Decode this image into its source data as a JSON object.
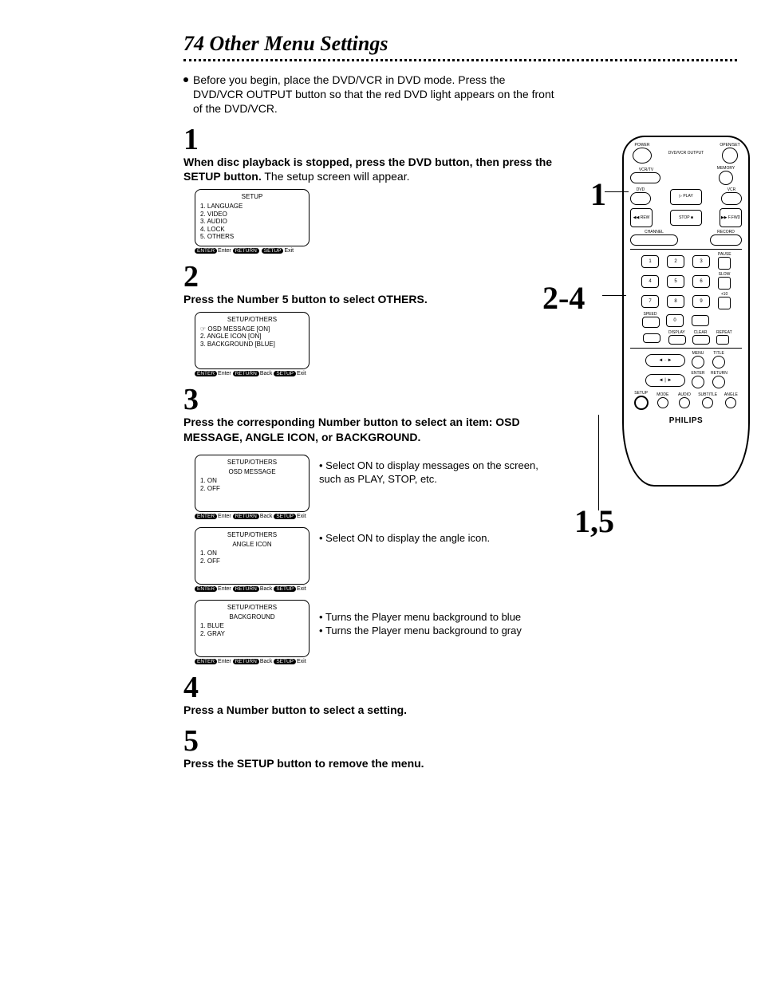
{
  "title": "74  Other Menu Settings",
  "intro": "Before you begin, place the DVD/VCR in DVD mode. Press the DVD/VCR OUTPUT button so that the red DVD light appears on the front of the DVD/VCR.",
  "steps": {
    "s1": {
      "num": "1",
      "text_bold": "When disc playback is stopped, press the DVD button, then press the SETUP button.",
      "text_rest": " The setup screen will appear."
    },
    "s2": {
      "num": "2",
      "text_bold": "Press the Number 5 button to select OTHERS."
    },
    "s3": {
      "num": "3",
      "text_bold": "Press the corresponding Number button to select an item: OSD MESSAGE, ANGLE ICON, or BACKGROUND."
    },
    "s4": {
      "num": "4",
      "text_bold": "Press a Number button to select a setting."
    },
    "s5": {
      "num": "5",
      "text_bold": "Press the SETUP button to remove the menu."
    }
  },
  "menu1": {
    "title": "SETUP",
    "items": [
      "1. LANGUAGE",
      "2. VIDEO",
      "3. AUDIO",
      "4. LOCK",
      "5. OTHERS"
    ]
  },
  "menu2": {
    "title": "SETUP/OTHERS",
    "items": [
      "☞ OSD MESSAGE  [ON]",
      "2. ANGLE ICON     [ON]",
      "3. BACKGROUND  [BLUE]"
    ]
  },
  "menu3a": {
    "title": "SETUP/OTHERS",
    "sub": "OSD MESSAGE",
    "items": [
      "1. ON",
      "2. OFF"
    ],
    "annot": "Select ON to display messages on the screen, such as PLAY, STOP, etc."
  },
  "menu3b": {
    "title": "SETUP/OTHERS",
    "sub": "ANGLE ICON",
    "items": [
      "1. ON",
      "2. OFF"
    ],
    "annot": "Select ON to display the angle icon."
  },
  "menu3c": {
    "title": "SETUP/OTHERS",
    "sub": "BACKGROUND",
    "items": [
      "1. BLUE",
      "2. GRAY"
    ],
    "annot1": "Turns the Player menu background to blue",
    "annot2": "Turns the Player menu background to gray"
  },
  "footer_labels": {
    "enter": "ENTER",
    "enter_t": "Enter",
    "return": "RETURN",
    "back": "Back",
    "setup": "SETUP",
    "exit": "Exit"
  },
  "callouts": {
    "c1": "1",
    "c2": "2-4",
    "c3": "1,5"
  },
  "remote": {
    "brand": "PHILIPS",
    "labels": {
      "power": "POWER",
      "dvdvcr_out": "DVD/VCR OUTPUT",
      "memory": "MEMORY",
      "vcrtv": "VCR/TV",
      "dvd": "DVD",
      "vcr": "VCR",
      "play": "▷ PLAY",
      "rew": "◀◀ REW",
      "stop": "STOP ■",
      "ffwd": "▶▶ F.FWD",
      "channel": "CHANNEL",
      "record": "RECORD",
      "pause": "PAUSE",
      "slow": "SLOW",
      "speed": "SPEED",
      "plus10": "+10",
      "display": "DISPLAY",
      "clear": "CLEAR",
      "repeat": "REPEAT",
      "menu": "MENU",
      "title": "TITLE",
      "enter": "ENTER",
      "return": "RETURN",
      "setup": "SETUP",
      "mode": "MODE",
      "audio": "AUDIO",
      "subtitle": "SUBTITLE",
      "angle": "ANGLE"
    }
  }
}
